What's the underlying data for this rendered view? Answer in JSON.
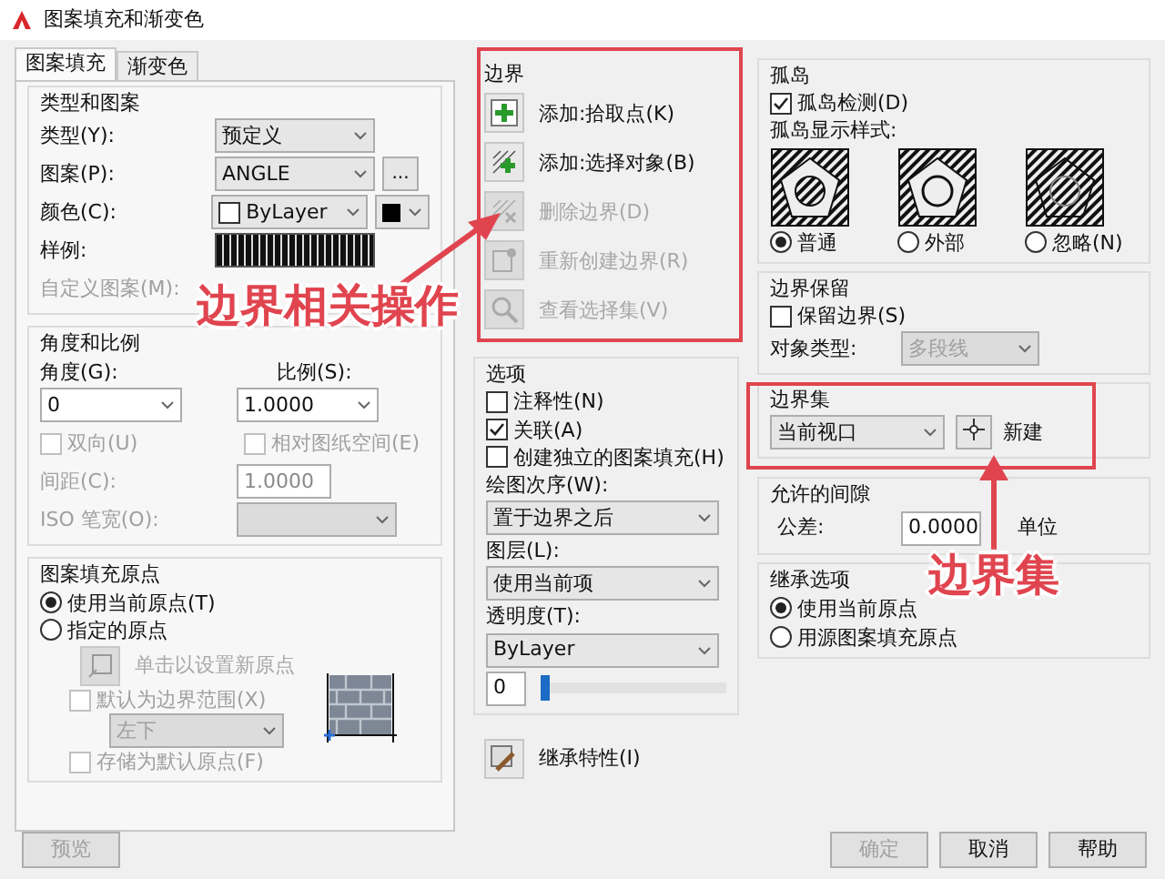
{
  "window": {
    "title": "图案填充和渐变色"
  },
  "tabs": [
    {
      "label": "图案填充",
      "selected": true
    },
    {
      "label": "渐变色",
      "selected": false
    }
  ],
  "type_and_pattern": {
    "title": "类型和图案",
    "fields": [
      {
        "kind": "combo",
        "label": "类型(Y):",
        "value": "预定义",
        "disabled": false
      },
      {
        "kind": "combo_browse",
        "label": "图案(P):",
        "value": "ANGLE",
        "browse": "...",
        "disabled": false
      },
      {
        "kind": "color",
        "label": "颜色(C):",
        "value": "ByLayer",
        "disabled": false
      },
      {
        "kind": "swatch",
        "label": "样例:",
        "disabled": false
      },
      {
        "kind": "blank",
        "label": "自定义图案(M):",
        "disabled": true
      }
    ]
  },
  "angle_and_scale": {
    "title": "角度和比例",
    "angle": {
      "label": "角度(G):",
      "value": "0"
    },
    "scale": {
      "label": "比例(S):",
      "value": "1.0000"
    },
    "checkboxes": [
      {
        "label": "双向(U)",
        "checked": false,
        "disabled": true
      },
      {
        "label": "相对图纸空间(E)",
        "checked": false,
        "disabled": true
      }
    ],
    "spacing": {
      "label": "间距(C):",
      "value": "1.0000",
      "disabled": true
    },
    "pen_width": {
      "label": "ISO 笔宽(O):",
      "disabled": true
    }
  },
  "origin": {
    "title": "图案填充原点",
    "radios": [
      {
        "label": "使用当前原点(T)",
        "selected": true
      },
      {
        "label": "指定的原点",
        "selected": false
      }
    ],
    "set_button": {
      "label": "单击以设置新原点",
      "disabled": true
    },
    "default_extents": {
      "label": "默认为边界范围(X)",
      "checked": false,
      "disabled": true
    },
    "position": {
      "value": "左下",
      "disabled": true
    },
    "store_default": {
      "label": "存储为默认原点(F)",
      "checked": false,
      "disabled": true
    }
  },
  "boundaries": {
    "title": "边界",
    "buttons": [
      {
        "kind": "pick",
        "label": "添加:拾取点(K)",
        "disabled": false
      },
      {
        "kind": "select",
        "label": "添加:选择对象(B)",
        "disabled": false
      },
      {
        "kind": "remove",
        "label": "删除边界(D)",
        "disabled": true
      },
      {
        "kind": "recreate",
        "label": "重新创建边界(R)",
        "disabled": true
      },
      {
        "kind": "view",
        "label": "查看选择集(V)",
        "disabled": true
      }
    ]
  },
  "options": {
    "title": "选项",
    "checkboxes": [
      {
        "label": "注释性(N)",
        "checked": false
      },
      {
        "label": "关联(A)",
        "checked": true
      },
      {
        "label": "创建独立的图案填充(H)",
        "checked": false
      }
    ],
    "draw_order": {
      "label": "绘图次序(W):",
      "value": "置于边界之后"
    },
    "layer": {
      "label": "图层(L):",
      "value": "使用当前项"
    },
    "transparency": {
      "label": "透明度(T):",
      "value": "ByLayer",
      "amount": "0",
      "level": 0
    }
  },
  "inherit_button": {
    "label": "继承特性(I)"
  },
  "islands": {
    "title": "孤岛",
    "detect": {
      "label": "孤岛检测(D)",
      "checked": true
    },
    "style_label": "孤岛显示样式:",
    "styles": [
      {
        "kind": "normal",
        "label": "普通",
        "selected": true
      },
      {
        "kind": "outer",
        "label": "外部",
        "selected": false
      },
      {
        "kind": "ignore",
        "label": "忽略(N)",
        "selected": false
      }
    ]
  },
  "retention": {
    "title": "边界保留",
    "retain": {
      "label": "保留边界(S)",
      "checked": false
    },
    "object_type": {
      "label": "对象类型:",
      "value": "多段线",
      "disabled": true
    }
  },
  "boundary_set": {
    "title": "边界集",
    "value": "当前视口",
    "new_label": "新建"
  },
  "gap": {
    "title": "允许的间隙",
    "label": "公差:",
    "value": "0.0000",
    "unit": "单位"
  },
  "inherit_options": {
    "title": "继承选项",
    "radios": [
      {
        "label": "使用当前原点",
        "selected": true
      },
      {
        "label": "用源图案填充原点",
        "selected": false
      }
    ]
  },
  "buttons": [
    {
      "kind": "preview",
      "label": "预览",
      "disabled": true
    },
    {
      "kind": "ok",
      "label": "确定",
      "disabled": true
    },
    {
      "kind": "cancel",
      "label": "取消",
      "disabled": false
    },
    {
      "kind": "help",
      "label": "帮助",
      "disabled": false
    }
  ],
  "annotations": [
    {
      "kind": "boundary_ops",
      "text": "边界相关操作"
    },
    {
      "kind": "boundary_set",
      "text": "边界集"
    }
  ]
}
